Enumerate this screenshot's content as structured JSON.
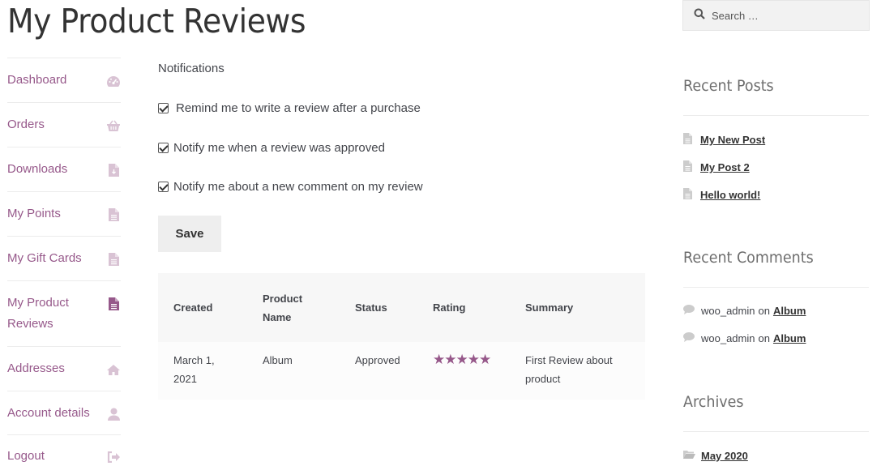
{
  "page": {
    "title": "My Product Reviews"
  },
  "nav": {
    "items": [
      {
        "label": "Dashboard",
        "icon": "dashboard-icon"
      },
      {
        "label": "Orders",
        "icon": "basket-icon"
      },
      {
        "label": "Downloads",
        "icon": "file-download-icon"
      },
      {
        "label": "My Points",
        "icon": "file-icon"
      },
      {
        "label": "My Gift Cards",
        "icon": "file-icon"
      },
      {
        "label": "My Product Reviews",
        "icon": "file-icon",
        "active": true
      },
      {
        "label": "Addresses",
        "icon": "home-icon"
      },
      {
        "label": "Account details",
        "icon": "user-icon"
      },
      {
        "label": "Logout",
        "icon": "sign-out-icon"
      }
    ]
  },
  "notifications": {
    "title": "Notifications",
    "options": [
      {
        "label": "Remind me to write a review after a purchase",
        "checked": true
      },
      {
        "label": "Notify me when a review was approved",
        "checked": true
      },
      {
        "label": "Notify me about a new comment on my review",
        "checked": true
      }
    ],
    "save_label": "Save"
  },
  "reviews_table": {
    "headers": [
      "Created",
      "Product Name",
      "Status",
      "Rating",
      "Summary"
    ],
    "rows": [
      {
        "created": "March 1, 2021",
        "product": "Album",
        "status": "Approved",
        "rating": 5,
        "rating_display": "★★★★★",
        "summary": "First Review about product"
      }
    ]
  },
  "sidebar": {
    "search_placeholder": "Search …",
    "recent_posts_title": "Recent Posts",
    "recent_posts": [
      "My New Post",
      "My Post 2",
      "Hello world!"
    ],
    "recent_comments_title": "Recent Comments",
    "recent_comments": [
      {
        "author": "woo_admin",
        "on": "on",
        "post": "Album"
      },
      {
        "author": "woo_admin",
        "on": "on",
        "post": "Album"
      }
    ],
    "archives_title": "Archives",
    "archives": [
      "May 2020"
    ]
  },
  "colors": {
    "accent": "#96588a",
    "nav_icon": "#d9c3d4",
    "text": "#43454b"
  }
}
